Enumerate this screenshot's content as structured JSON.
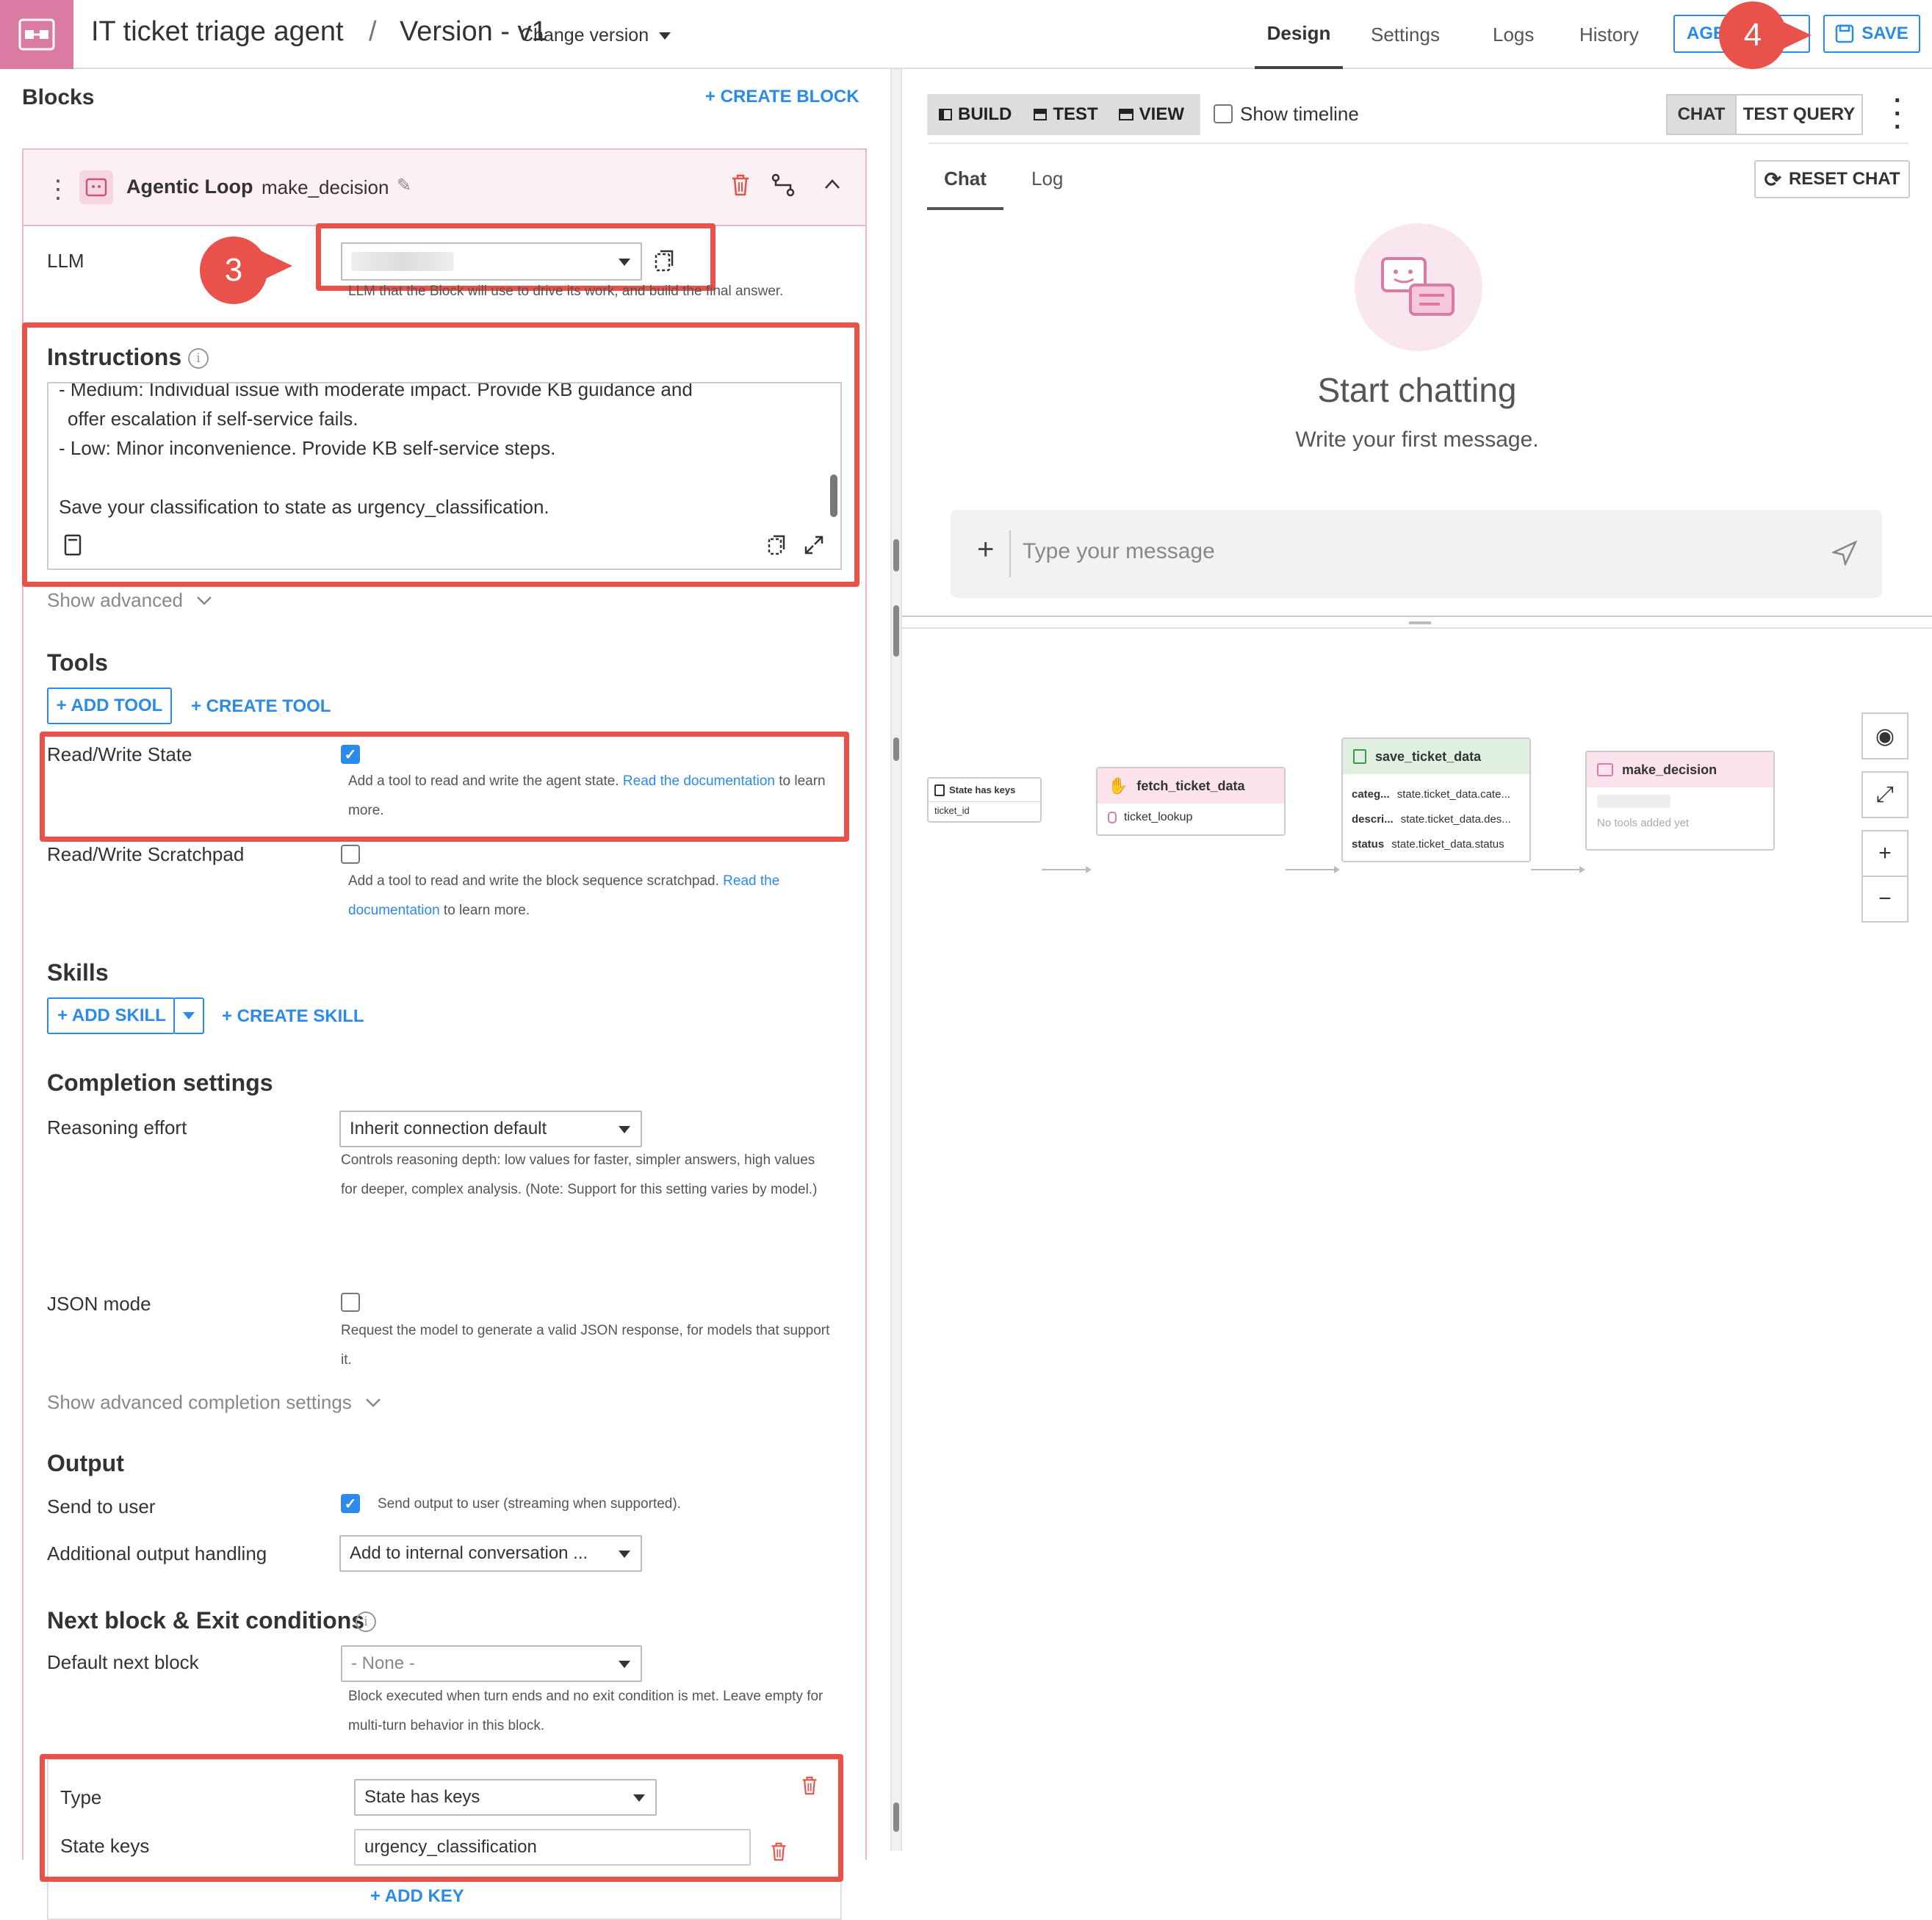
{
  "header": {
    "title": "IT ticket triage agent",
    "separator": "/",
    "version": "Version - v1",
    "change_version": "Change version",
    "tabs": [
      "Design",
      "Settings",
      "Logs",
      "History"
    ],
    "agent_btn": "AGE",
    "save_btn": "SAVE"
  },
  "left": {
    "blocks_title": "Blocks",
    "create_block": "+ CREATE BLOCK",
    "block": {
      "type": "Agentic Loop",
      "name": "make_decision"
    },
    "llm": {
      "label": "LLM",
      "help": "LLM that the Block will use to drive its work, and build the final answer."
    },
    "instructions": {
      "title": "Instructions",
      "lines": [
        "- Medium: Individual issue with moderate impact. Provide KB guidance and",
        "offer escalation if self-service fails.",
        "- Low: Minor inconvenience. Provide KB self-service steps.",
        "",
        "Save your classification to state as urgency_classification."
      ]
    },
    "show_advanced": "Show advanced",
    "tools": {
      "title": "Tools",
      "add_tool": "+ ADD TOOL",
      "create_tool": "+ CREATE TOOL",
      "rw_state": {
        "label": "Read/Write State",
        "help1": "Add a tool to read and write the agent state. ",
        "link": "Read the documentation",
        "help2": " to learn",
        "help3": "more."
      },
      "rw_scratch": {
        "label": "Read/Write Scratchpad",
        "help1": "Add a tool to read and write the block sequence scratchpad. ",
        "link1": "Read the",
        "link2": "documentation",
        "help2": " to learn more."
      }
    },
    "skills": {
      "title": "Skills",
      "add_skill": "+ ADD SKILL",
      "create_skill": "+ CREATE SKILL"
    },
    "completion": {
      "title": "Completion settings",
      "reasoning_label": "Reasoning effort",
      "reasoning_value": "Inherit connection default",
      "reasoning_help1": "Controls reasoning depth: low values for faster, simpler answers, high values",
      "reasoning_help2": "for deeper, complex analysis. (Note: Support for this setting varies by model.)",
      "json_label": "JSON mode",
      "json_help1": "Request the model to generate a valid JSON response, for models that support",
      "json_help2": "it.",
      "show_adv": "Show advanced completion settings"
    },
    "output": {
      "title": "Output",
      "send_label": "Send to user",
      "send_help": "Send output to user (streaming when supported).",
      "addl_label": "Additional output handling",
      "addl_value": "Add to internal conversation ..."
    },
    "next": {
      "title": "Next block & Exit conditions",
      "default_label": "Default next block",
      "default_value": "- None -",
      "help1": "Block executed when turn ends and no exit condition is met. Leave empty for",
      "help2": "multi-turn behavior in this block.",
      "type_label": "Type",
      "type_value": "State has keys",
      "keys_label": "State keys",
      "keys_value": "urgency_classification",
      "add_key": "+ ADD KEY"
    }
  },
  "right": {
    "modes": [
      "BUILD",
      "TEST",
      "VIEW"
    ],
    "show_timeline": "Show timeline",
    "chat_tab": "CHAT",
    "test_query": "TEST QUERY",
    "subtabs": [
      "Chat",
      "Log"
    ],
    "reset_chat": "RESET CHAT",
    "start_title": "Start chatting",
    "start_sub": "Write your first message.",
    "placeholder": "Type your message"
  },
  "graph": {
    "start": {
      "title": "State has keys",
      "key": "ticket_id"
    },
    "fetch": {
      "title": "fetch_ticket_data",
      "tool": "ticket_lookup"
    },
    "save": {
      "title": "save_ticket_data",
      "rows": [
        [
          "categ...",
          "state.ticket_data.cate..."
        ],
        [
          "descri...",
          "state.ticket_data.des..."
        ],
        [
          "status",
          "state.ticket_data.status"
        ]
      ]
    },
    "decision": {
      "title": "make_decision",
      "no_tools": "No tools added yet"
    }
  },
  "annotations": {
    "step3": "3",
    "step4": "4"
  },
  "colors": {
    "accent": "#2c8ae8",
    "brand": "#d97ba3",
    "highlight": "#e8524a"
  }
}
